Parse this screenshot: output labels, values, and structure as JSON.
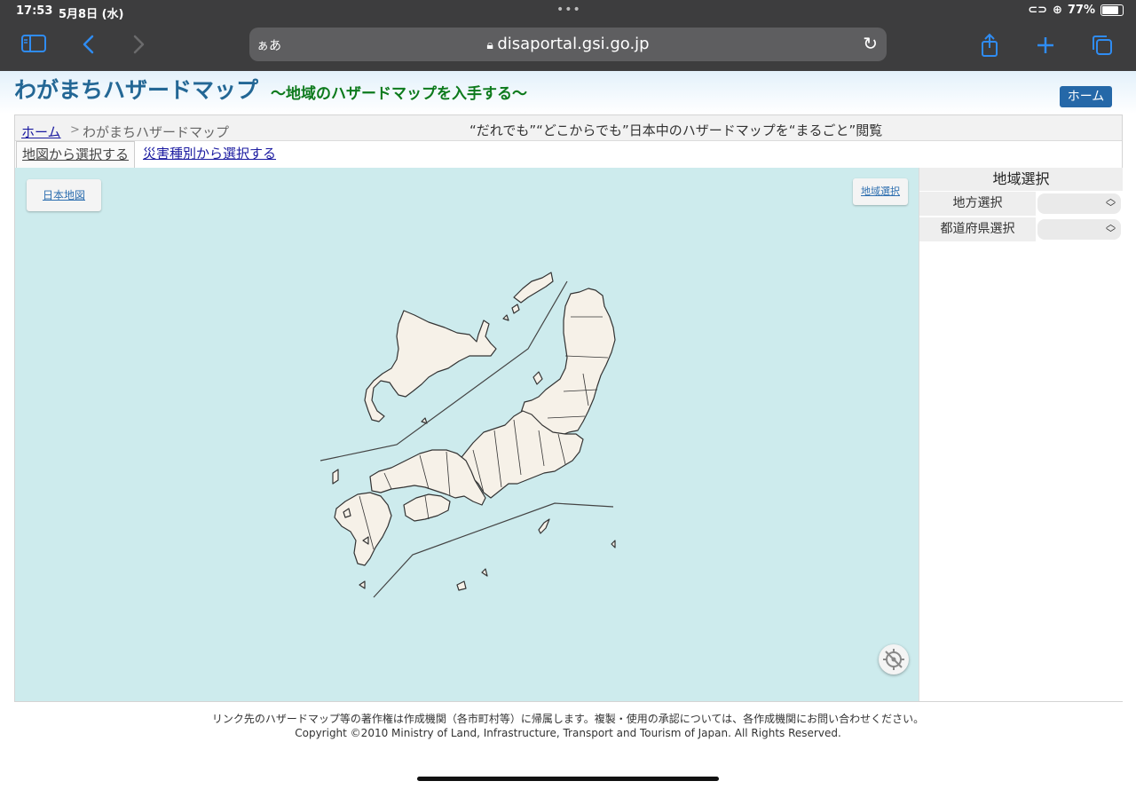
{
  "status": {
    "time": "17:53",
    "date": "5月8日 (水)",
    "battery": "77%",
    "battery_level": 0.77
  },
  "browser": {
    "aa_label": "ぁあ",
    "url": "disaportal.gsi.go.jp",
    "accent": "#2f8cf2"
  },
  "header": {
    "title": "わがまちハザードマップ",
    "subtitle": "〜地域のハザードマップを入手する〜",
    "home_button": "ホーム"
  },
  "breadcrumb": {
    "home": "ホーム",
    "separator": ">",
    "current": "わがまちハザードマップ"
  },
  "tagline": "“だれでも”“どこからでも”日本中のハザードマップを“まるごと”閲覧",
  "tabs": [
    {
      "label": "地図から選択する",
      "active": true
    },
    {
      "label": "災害種別から選択する",
      "active": false
    }
  ],
  "map": {
    "japan_map_label": "日本地図",
    "region_select_label": "地域選択"
  },
  "sidebar": {
    "title": "地域選択",
    "rows": [
      {
        "label": "地方選択",
        "value": ""
      },
      {
        "label": "都道府県選択",
        "value": ""
      }
    ]
  },
  "footer": {
    "line1": "リンク先のハザードマップ等の著作権は作成機関（各市町村等）に帰属します。複製・使用の承認については、各作成機関にお問い合わせください。",
    "line2": "Copyright ©2010 Ministry of Land, Infrastructure, Transport and Tourism of Japan. All Rights Reserved."
  }
}
